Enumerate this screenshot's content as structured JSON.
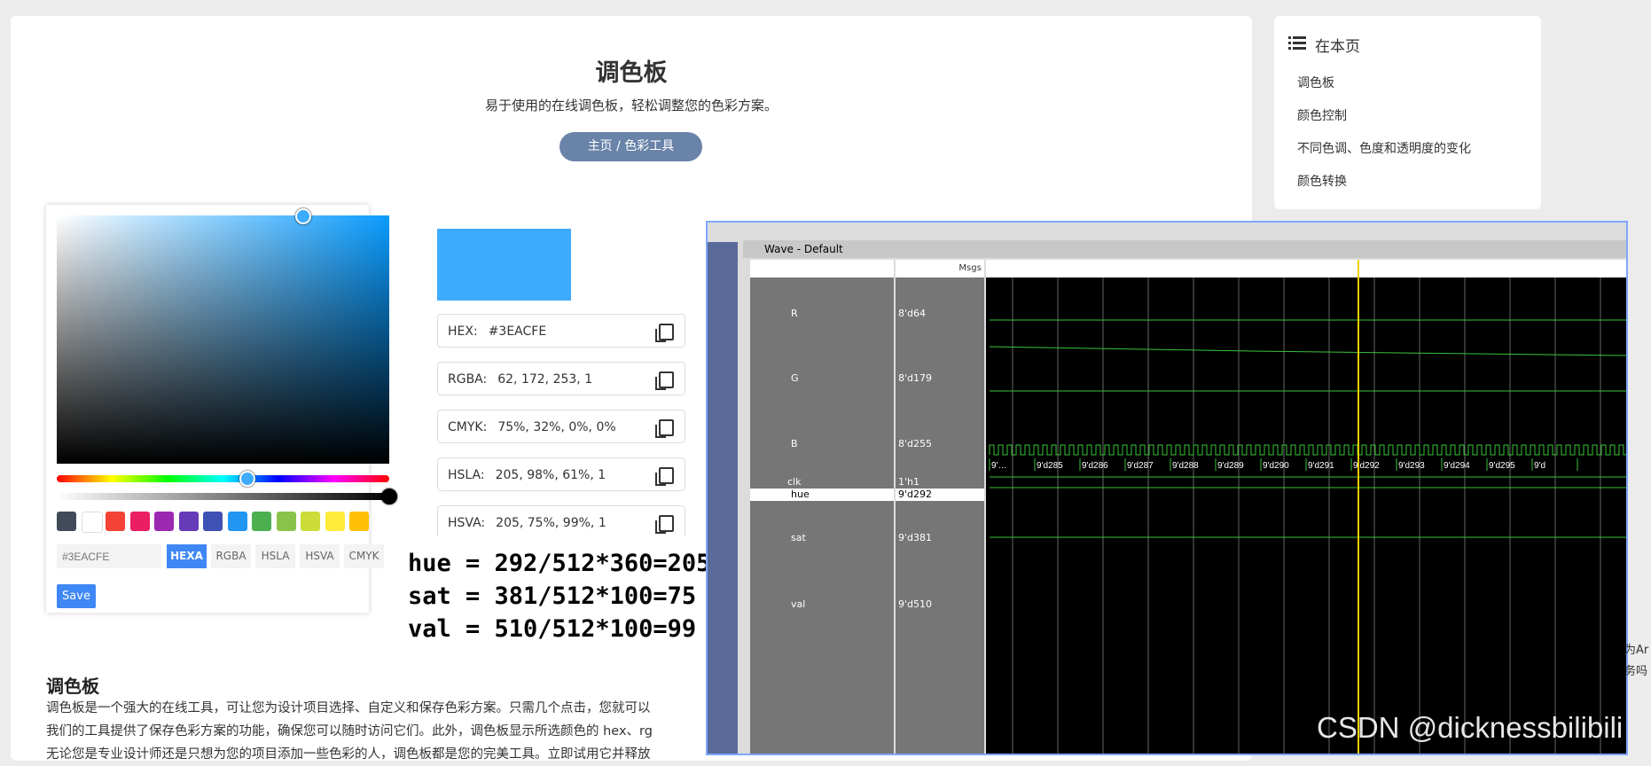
{
  "header": {
    "title": "调色板",
    "subtitle": "易于使用的在线调色板，轻松调整您的色彩方案。",
    "breadcrumb": "主页 / 色彩工具"
  },
  "toc": {
    "title": "在本页",
    "items": [
      "调色板",
      "颜色控制",
      "不同色调、色度和透明度的变化",
      "颜色转换"
    ]
  },
  "picker": {
    "hex_value": "#3EACFE",
    "formats": [
      "HEXA",
      "RGBA",
      "HSLA",
      "HSVA",
      "CMYK"
    ],
    "active_format": "HEXA",
    "save": "Save",
    "swatches": [
      "#424b5a",
      "#ffffff",
      "#f44336",
      "#e91e63",
      "#9c27b0",
      "#673ab7",
      "#3f51b5",
      "#2196f3",
      "#4caf50",
      "#8bc34a",
      "#cddc39",
      "#ffeb3b",
      "#ffc107"
    ],
    "preview_color": "#3EACFE"
  },
  "values": [
    {
      "label": "HEX:",
      "value": "#3EACFE"
    },
    {
      "label": "RGBA:",
      "value": "62, 172, 253, 1"
    },
    {
      "label": "CMYK:",
      "value": "75%, 32%, 0%, 0%"
    },
    {
      "label": "HSLA:",
      "value": "205, 98%, 61%, 1"
    },
    {
      "label": "HSVA:",
      "value": "205, 75%, 99%, 1"
    }
  ],
  "article": {
    "heading": "调色板",
    "lines": [
      "调色板是一个强大的在线工具，可让您为设计项目选择、自定义和保存色彩方案。只需几个点击，您就可以",
      "我们的工具提供了保存色彩方案的功能，确保您可以随时访问它们。此外，调色板显示所选颜色的 hex、rg",
      "无论您是专业设计师还是只想为您的项目添加一些色彩的人，调色板都是您的完美工具。立即试用它并释放"
    ]
  },
  "formula": [
    "hue = 292/512*360=205",
    "sat =  381/512*100=75",
    "val =  510/512*100=99"
  ],
  "wave": {
    "title": "Wave - Default",
    "msgs_header": "Msgs",
    "signals": [
      {
        "name": "R",
        "value": "8'd64"
      },
      {
        "name": "G",
        "value": "8'd179"
      },
      {
        "name": "B",
        "value": "8'd255"
      },
      {
        "name": "clk",
        "value": "1'h1"
      },
      {
        "name": "hue",
        "value": "9'd292"
      },
      {
        "name": "sat",
        "value": "9'd381"
      },
      {
        "name": "val",
        "value": "9'd510"
      }
    ],
    "hue_bus": [
      "9'…",
      "9'd285",
      "9'd286",
      "9'd287",
      "9'd288",
      "9'd289",
      "9'd290",
      "9'd291",
      "9'd292",
      "9'd293",
      "9'd294",
      "9'd295",
      "9'd"
    ]
  },
  "watermark": "CSDN @dicknessbilibili",
  "edge_text": [
    "为Ar",
    "务吗"
  ]
}
